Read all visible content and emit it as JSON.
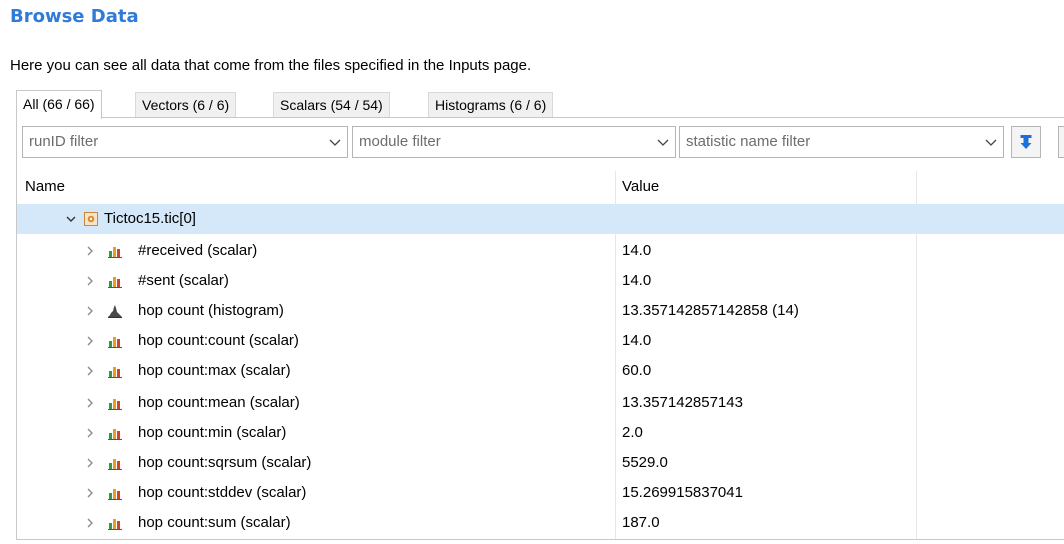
{
  "header": {
    "title": "Browse Data",
    "description": "Here you can see all data that come from the files specified in the Inputs page."
  },
  "tabs": [
    {
      "label": "All (66 / 66)"
    },
    {
      "label": "Vectors (6 / 6)"
    },
    {
      "label": "Scalars (54 / 54)"
    },
    {
      "label": "Histograms (6 / 6)"
    }
  ],
  "filters": {
    "run_id": "runID filter",
    "module": "module filter",
    "statistic": "statistic name filter"
  },
  "columns": {
    "name": "Name",
    "value": "Value"
  },
  "tree": {
    "root": {
      "name": "Tictoc15.tic[0]",
      "icon": "module-icon"
    },
    "rows": [
      {
        "name": "#received (scalar)",
        "value": "14.0",
        "icon": "scalar-icon"
      },
      {
        "name": "#sent (scalar)",
        "value": "14.0",
        "icon": "scalar-icon"
      },
      {
        "name": "hop count (histogram)",
        "value": "13.357142857142858 (14)",
        "icon": "histogram-icon"
      },
      {
        "name": "hop count:count (scalar)",
        "value": "14.0",
        "icon": "scalar-icon"
      },
      {
        "name": "hop count:max (scalar)",
        "value": "60.0",
        "icon": "scalar-icon"
      },
      {
        "name": "hop count:mean (scalar)",
        "value": "13.357142857143",
        "icon": "scalar-icon"
      },
      {
        "name": "hop count:min (scalar)",
        "value": "2.0",
        "icon": "scalar-icon"
      },
      {
        "name": "hop count:sqrsum (scalar)",
        "value": "5529.0",
        "icon": "scalar-icon"
      },
      {
        "name": "hop count:stddev (scalar)",
        "value": "15.269915837041",
        "icon": "scalar-icon"
      },
      {
        "name": "hop count:sum (scalar)",
        "value": "187.0",
        "icon": "scalar-icon"
      }
    ]
  },
  "colors": {
    "title": "#2f7bd8",
    "selection": "#d4e8fa",
    "accent": "#1e6fd9"
  }
}
